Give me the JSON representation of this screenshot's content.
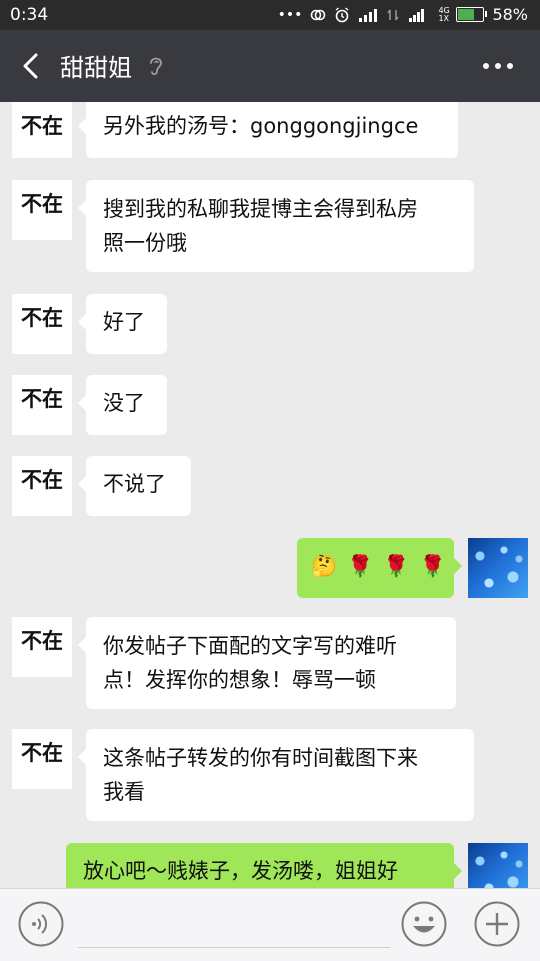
{
  "status_bar": {
    "time": "0:34",
    "dots": "•••",
    "battery_percent": "58%",
    "battery_level": 0.58,
    "network_label": "4G 1X"
  },
  "header": {
    "title": "甜甜姐",
    "more": "•••"
  },
  "contact_avatar_text": "不在",
  "messages": [
    {
      "side": "left",
      "lines": [
        "另外我的汤号：gonggongjingce"
      ]
    },
    {
      "side": "left",
      "lines": [
        "搜到我的私聊我提博主会得到私房",
        "照一份哦"
      ]
    },
    {
      "side": "left",
      "lines": [
        "好了"
      ]
    },
    {
      "side": "left",
      "lines": [
        "没了"
      ]
    },
    {
      "side": "left",
      "lines": [
        "不说了"
      ]
    },
    {
      "side": "right",
      "emoji": [
        "🤔",
        "🌹",
        "🌹",
        "🌹"
      ]
    },
    {
      "side": "left",
      "lines": [
        "你发帖子下面配的文字写的难听",
        "点！发挥你的想象！辱骂一顿"
      ]
    },
    {
      "side": "left",
      "lines": [
        "这条帖子转发的你有时间截图下来",
        "我看"
      ]
    },
    {
      "side": "right",
      "lines": [
        "放心吧～贱婊子，发汤喽，姐姐好"
      ]
    }
  ],
  "colors": {
    "navbar": "#393a3f",
    "statusbar": "#2b2b2b",
    "chat_bg": "#ebebeb",
    "sent_bubble": "#9fe658",
    "received_bubble": "#ffffff"
  },
  "icons": {
    "back": "chevron-left-icon",
    "ear": "ear-icon",
    "more": "more-dots-icon",
    "voice": "voice-icon",
    "emoji": "emoji-icon",
    "plus": "plus-icon"
  }
}
